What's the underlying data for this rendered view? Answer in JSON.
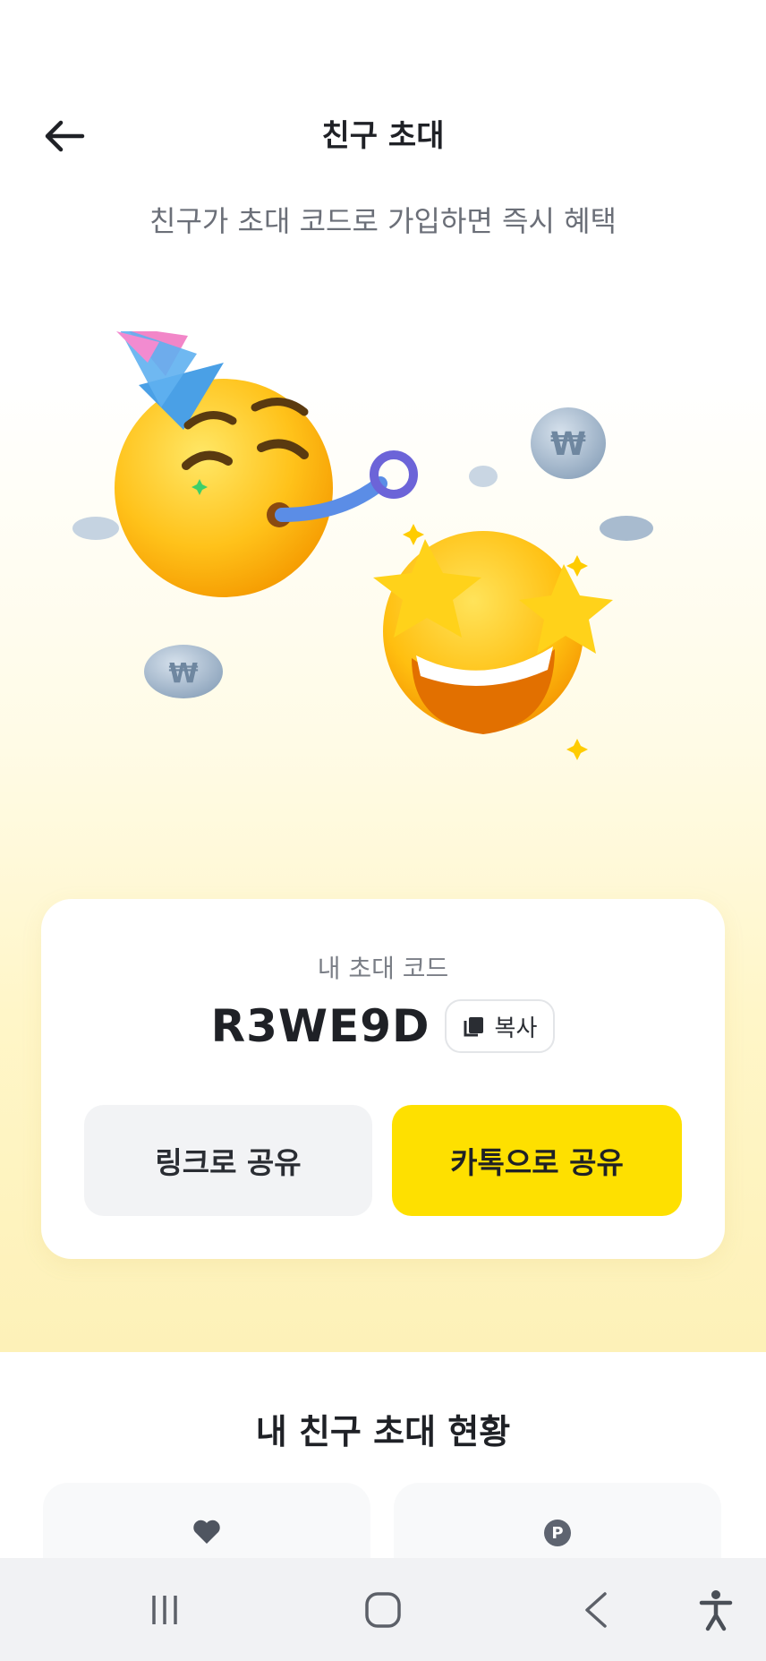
{
  "header": {
    "title": "친구 초대",
    "subtitle": "친구가 초대 코드로 가입하면 즉시 혜택"
  },
  "code_card": {
    "label": "내 초대 코드",
    "code": "R3WE9D",
    "copy_label": "복사",
    "share_link_label": "링크로 공유",
    "share_kakao_label": "카톡으로 공유"
  },
  "status": {
    "title": "내 친구 초대 현황",
    "cards": [
      {
        "icon": "heart-icon"
      },
      {
        "icon": "point-icon"
      }
    ]
  },
  "colors": {
    "kakao_yellow": "#fee000",
    "link_button_bg": "#f2f3f5",
    "text_primary": "#1f2126",
    "text_secondary": "#6b6f78"
  },
  "nav": {
    "items": [
      "recent-apps-icon",
      "home-icon",
      "back-nav-icon",
      "accessibility-icon"
    ]
  }
}
